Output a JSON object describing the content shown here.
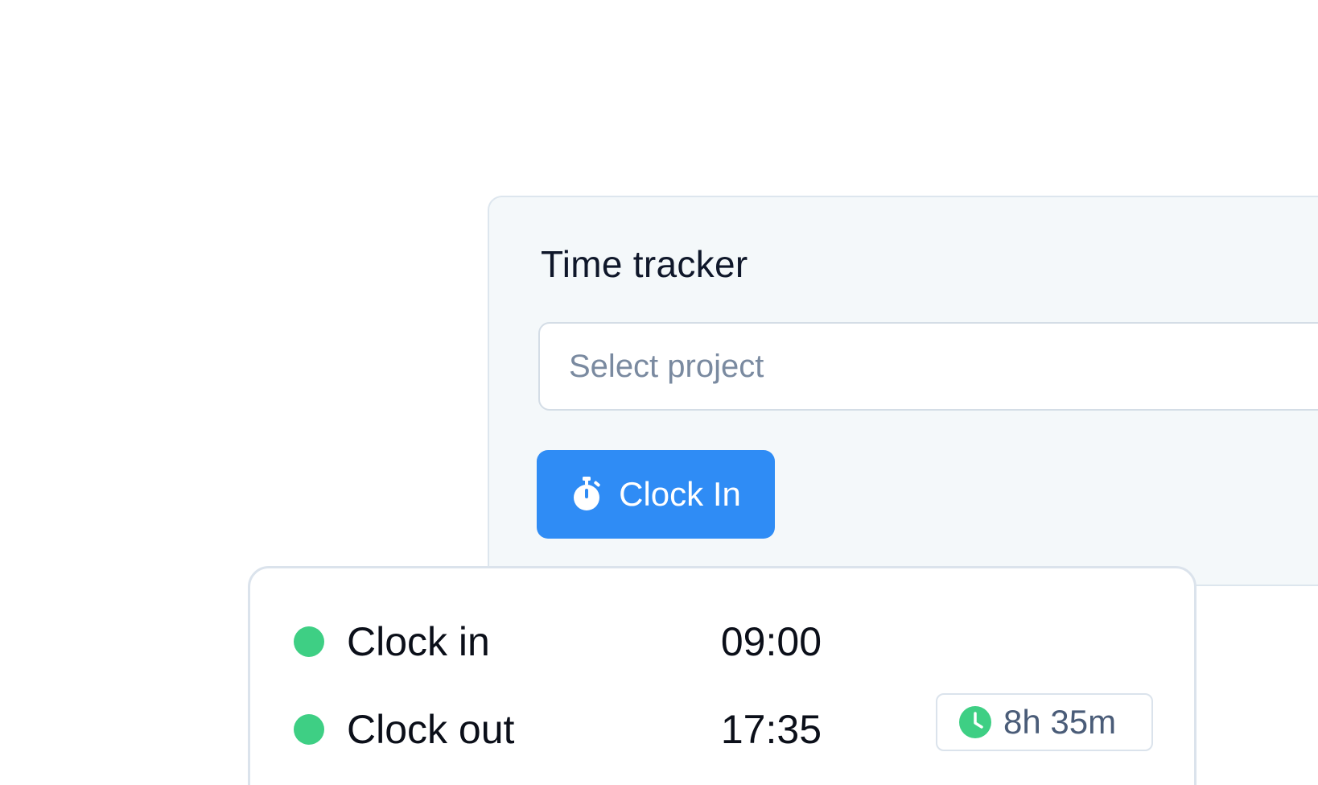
{
  "tracker": {
    "title": "Time tracker",
    "project_placeholder": "Select project",
    "clock_in_button_label": "Clock In",
    "clock_in_button_icon": "stopwatch-icon"
  },
  "log": {
    "rows": [
      {
        "label": "Clock in",
        "time": "09:00",
        "status_color": "#3ecf84"
      },
      {
        "label": "Clock out",
        "time": "17:35",
        "status_color": "#3ecf84"
      }
    ],
    "duration": {
      "icon": "clock-icon",
      "value": "8h 35m"
    }
  },
  "colors": {
    "accent": "#2f8cf5",
    "status_green": "#3ecf84",
    "card_background": "#f4f8fa",
    "title_text": "#0f172a"
  }
}
